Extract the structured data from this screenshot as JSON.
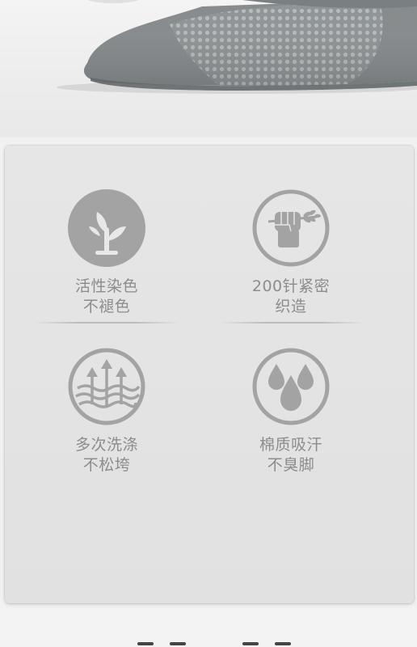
{
  "features": [
    {
      "icon": "sprout-icon",
      "line1": "活性染色",
      "line2": "不褪色"
    },
    {
      "icon": "fist-icon",
      "line1": "200针紧密",
      "line2": "织造"
    },
    {
      "icon": "stretch-arrows-icon",
      "line1": "多次洗涤",
      "line2": "不松垮"
    },
    {
      "icon": "water-drops-icon",
      "line1": "棉质吸汗",
      "line2": "不臭脚"
    }
  ],
  "colors": {
    "icon_gray": "#a3a3a3",
    "text_gray": "#8c8c8c",
    "card_bg": "#e4e4e4"
  }
}
